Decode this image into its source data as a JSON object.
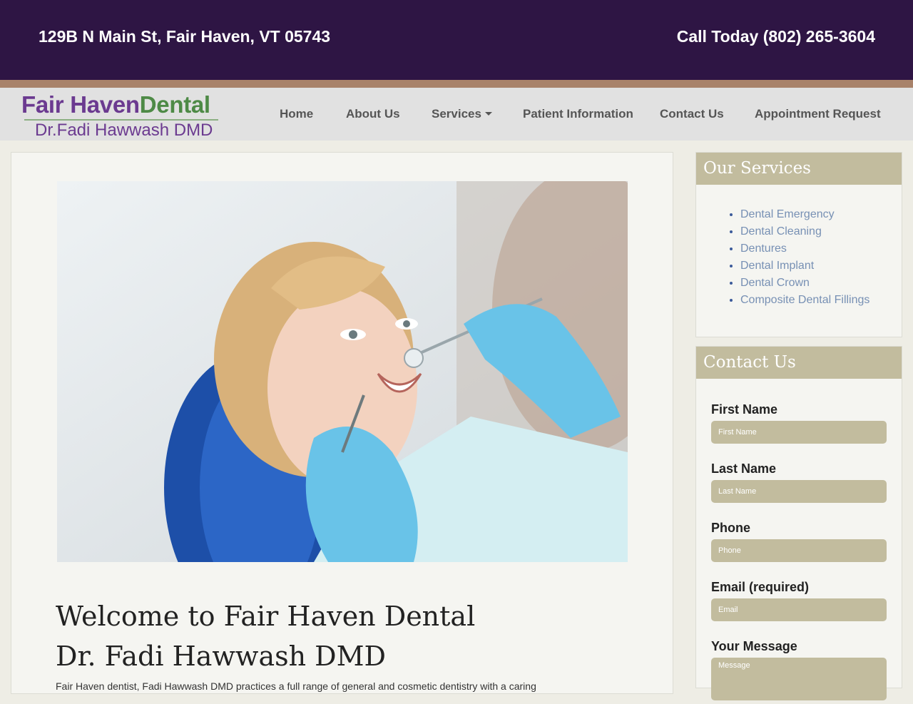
{
  "topbar": {
    "address": "129B N Main St, Fair Haven, VT 05743",
    "phone": "Call Today (802) 265-3604"
  },
  "logo": {
    "line1_part1": "Fair Haven",
    "line1_part2": "Dental",
    "line2": "Dr.Fadi Hawwash DMD"
  },
  "nav": {
    "items": [
      "Home",
      "About Us",
      "Services",
      "Patient Information",
      "Contact Us",
      "Appointment Request"
    ]
  },
  "main": {
    "hero_alt": "Dental patient smiling during a checkup",
    "welcome_line1": "Welcome to Fair Haven Dental",
    "welcome_line2": "Dr. Fadi Hawwash DMD",
    "intro": "Fair Haven dentist, Fadi Hawwash DMD practices a full range of general and cosmetic dentistry with a caring"
  },
  "services": {
    "title": "Our Services",
    "items": [
      "Dental Emergency",
      "Dental Cleaning",
      "Dentures",
      "Dental Implant",
      "Dental Crown",
      "Composite Dental Fillings"
    ]
  },
  "contact": {
    "title": "Contact Us",
    "fields": [
      {
        "label": "First Name",
        "placeholder": "First Name"
      },
      {
        "label": "Last Name",
        "placeholder": "Last Name"
      },
      {
        "label": "Phone",
        "placeholder": "Phone"
      },
      {
        "label": "Email (required)",
        "placeholder": "Email"
      },
      {
        "label": "Your Message",
        "placeholder": "Message"
      }
    ]
  },
  "colors": {
    "topbar": "#2e1544",
    "accent_stripe": "#a8826a",
    "panel_head": "#c2bc9e",
    "link": "#7790b4",
    "logo_purple": "#6b3a90",
    "logo_green": "#4e8a46"
  }
}
